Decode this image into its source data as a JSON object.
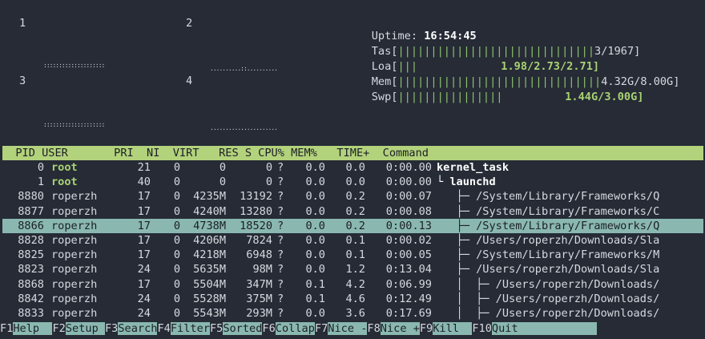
{
  "cpus": [
    {
      "label": "1"
    },
    {
      "label": "2"
    },
    {
      "label": "3"
    },
    {
      "label": "4"
    }
  ],
  "uptime": {
    "label": "Uptime: ",
    "value": "16:54:45"
  },
  "meters": [
    {
      "label": "Tas[",
      "bars": "||||||||||||||||||||||||||||||",
      "value": "3/1967]"
    },
    {
      "label": "Loa[",
      "bars": "|||",
      "value": "1.98/2.73/2.71]"
    },
    {
      "label": "Mem[",
      "bars": "|||||||||||||||||||||||||||||||",
      "value": "4.32G/8.00G]"
    },
    {
      "label": "Swp[",
      "bars": "||||||||||||||||",
      "value": "1.44G/3.00G]"
    }
  ],
  "graphs": {
    "g1": "::::::::::::::::::::",
    "g2": "..........::..........",
    "g3": "::::::::::::::::::::",
    "g4": "......................"
  },
  "table": {
    "header": "  PID USER       PRI  NI  VIRT   RES S CPU% MEM%   TIME+  Command",
    "rows": [
      {
        "pid": "0",
        "user": "root",
        "pri": "21",
        "ni": "0",
        "virt": "0",
        "res": "0",
        "s": "?",
        "cpu": "0.0",
        "mem": "0.0",
        "time": "0:00.00",
        "cmd": "kernel_task"
      },
      {
        "pid": "1",
        "user": "root",
        "pri": "40",
        "ni": "0",
        "virt": "0",
        "res": "0",
        "s": "?",
        "cpu": "0.0",
        "mem": "0.0",
        "time": "0:00.00",
        "cmd": "└ launchd"
      },
      {
        "pid": "8880",
        "user": "roperzh",
        "pri": "17",
        "ni": "0",
        "virt": "4235M",
        "res": "13192",
        "s": "?",
        "cpu": "0.0",
        "mem": "0.2",
        "time": "0:00.07",
        "cmd": "   ├─ /System/Library/Frameworks/Q"
      },
      {
        "pid": "8877",
        "user": "roperzh",
        "pri": "17",
        "ni": "0",
        "virt": "4240M",
        "res": "13280",
        "s": "?",
        "cpu": "0.0",
        "mem": "0.2",
        "time": "0:00.08",
        "cmd": "   ├─ /System/Library/Frameworks/C"
      },
      {
        "pid": "8866",
        "user": "roperzh",
        "pri": "17",
        "ni": "0",
        "virt": "4738M",
        "res": "18520",
        "s": "?",
        "cpu": "0.0",
        "mem": "0.2",
        "time": "0:00.13",
        "cmd": "   ├─ /System/Library/Frameworks/Q"
      },
      {
        "pid": "8828",
        "user": "roperzh",
        "pri": "17",
        "ni": "0",
        "virt": "4206M",
        "res": "7824",
        "s": "?",
        "cpu": "0.0",
        "mem": "0.1",
        "time": "0:00.02",
        "cmd": "   ├─ /Users/roperzh/Downloads/Sla"
      },
      {
        "pid": "8825",
        "user": "roperzh",
        "pri": "17",
        "ni": "0",
        "virt": "4218M",
        "res": "6948",
        "s": "?",
        "cpu": "0.0",
        "mem": "0.1",
        "time": "0:00.05",
        "cmd": "   ├─ /System/Library/Frameworks/M"
      },
      {
        "pid": "8823",
        "user": "roperzh",
        "pri": "24",
        "ni": "0",
        "virt": "5635M",
        "res": "98M",
        "s": "?",
        "cpu": "0.0",
        "mem": "1.2",
        "time": "0:13.04",
        "cmd": "   ├─ /Users/roperzh/Downloads/Sla"
      },
      {
        "pid": "8868",
        "user": "roperzh",
        "pri": "17",
        "ni": "0",
        "virt": "5504M",
        "res": "347M",
        "s": "?",
        "cpu": "0.1",
        "mem": "4.2",
        "time": "0:06.99",
        "cmd": "   │  ├─ /Users/roperzh/Downloads/"
      },
      {
        "pid": "8842",
        "user": "roperzh",
        "pri": "24",
        "ni": "0",
        "virt": "5528M",
        "res": "375M",
        "s": "?",
        "cpu": "0.1",
        "mem": "4.6",
        "time": "0:12.49",
        "cmd": "   │  ├─ /Users/roperzh/Downloads/"
      },
      {
        "pid": "8833",
        "user": "roperzh",
        "pri": "24",
        "ni": "0",
        "virt": "5543M",
        "res": "293M",
        "s": "?",
        "cpu": "0.0",
        "mem": "3.6",
        "time": "0:17.69",
        "cmd": "   │  ├─ /Users/roperzh/Downloads/"
      }
    ]
  },
  "footer": [
    {
      "key": "F1",
      "label": "Help  "
    },
    {
      "key": "F2",
      "label": "Setup "
    },
    {
      "key": "F3",
      "label": "Search"
    },
    {
      "key": "F4",
      "label": "Filter"
    },
    {
      "key": "F5",
      "label": "Sorted"
    },
    {
      "key": "F6",
      "label": "Collap"
    },
    {
      "key": "F7",
      "label": "Nice -"
    },
    {
      "key": "F8",
      "label": "Nice +"
    },
    {
      "key": "F9",
      "label": "Kill  "
    },
    {
      "key": "F10",
      "label": "Quit            "
    }
  ],
  "colors": {
    "background": "#262b36",
    "header": "#b3d27c",
    "selected": "#8ab8b0",
    "accent_green": "#8fc46e"
  }
}
